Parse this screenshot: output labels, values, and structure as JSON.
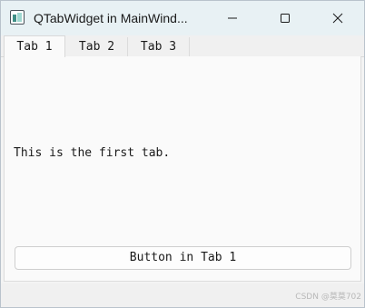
{
  "window": {
    "title": "QTabWidget in MainWind...",
    "app_icon": "qt-app-icon",
    "controls": {
      "minimize_icon": "minimize-icon",
      "maximize_icon": "maximize-icon",
      "close_icon": "close-icon"
    }
  },
  "tabs": [
    {
      "label": "Tab 1",
      "active": true
    },
    {
      "label": "Tab 2",
      "active": false
    },
    {
      "label": "Tab 3",
      "active": false
    }
  ],
  "content": {
    "label": "This is the first tab.",
    "button_label": "Button in Tab 1"
  },
  "watermark": "CSDN @莫莫702",
  "colors": {
    "titlebar_bg": "#e8f1f4",
    "window_bg": "#f3f3f3",
    "panel_bg": "#fafafa",
    "text": "#1a1a1a"
  }
}
